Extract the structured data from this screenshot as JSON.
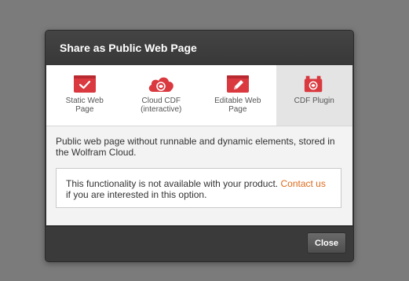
{
  "dialog": {
    "title": "Share as Public Web Page"
  },
  "options": [
    {
      "line1": "Static Web",
      "line2": "Page",
      "icon": "static-page-check-icon",
      "selected": false
    },
    {
      "line1": "Cloud CDF",
      "line2": "(interactive)",
      "icon": "cloud-cdf-icon",
      "selected": false
    },
    {
      "line1": "Editable Web",
      "line2": "Page",
      "icon": "editable-page-pencil-icon",
      "selected": false
    },
    {
      "line1": "CDF Plugin",
      "line2": "",
      "icon": "cdf-plugin-icon",
      "selected": true
    }
  ],
  "content": {
    "description": "Public web page without runnable and dynamic elements, stored in the Wolfram Cloud.",
    "notice_text": "This functionality is not available with your product.",
    "contact_link": "Contact us",
    "notice_tail": "if you are interested in this option."
  },
  "footer": {
    "close_label": "Close"
  },
  "colors": {
    "icon_red": "#d9393f",
    "link_orange": "#dd6a1c",
    "dialog_dark": "#3a3a3a",
    "backdrop": "#7b7b7b"
  }
}
